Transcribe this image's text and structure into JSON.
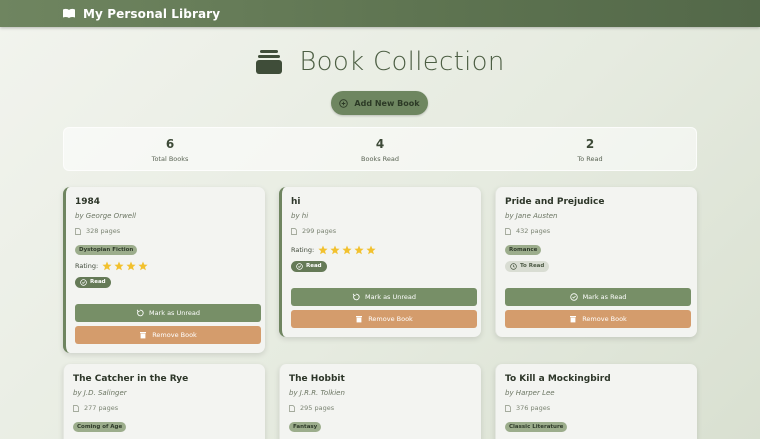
{
  "app": {
    "title": "My Personal Library"
  },
  "header": {
    "title": "Book Collection",
    "add_button": "Add New Book"
  },
  "stats": [
    {
      "value": "6",
      "label": "Total Books"
    },
    {
      "value": "4",
      "label": "Books Read"
    },
    {
      "value": "2",
      "label": "To Read"
    }
  ],
  "colors": {
    "accent": "#6f8560",
    "danger": "#d49c6c",
    "star": "#f2c12e",
    "background": "#e6ebe0"
  },
  "labels": {
    "rating": "Rating:",
    "read": "Read",
    "to_read": "To Read",
    "mark_unread": "Mark as Unread",
    "mark_read": "Mark as Read",
    "remove": "Remove Book"
  },
  "books": [
    {
      "title": "1984",
      "author": "by George Orwell",
      "pages": "328 pages",
      "genre": "Dystopian Fiction",
      "rating": 4,
      "status": "Read",
      "action": "Mark as Unread",
      "remove": "Remove Book"
    },
    {
      "title": "hi",
      "author": "by hi",
      "pages": "299 pages",
      "genre": "",
      "rating": 5,
      "status": "Read",
      "action": "Mark as Unread",
      "remove": "Remove Book"
    },
    {
      "title": "Pride and Prejudice",
      "author": "by Jane Austen",
      "pages": "432 pages",
      "genre": "Romance",
      "rating": 0,
      "status": "To Read",
      "action": "Mark as Read",
      "remove": "Remove Book"
    },
    {
      "title": "The Catcher in the Rye",
      "author": "by J.D. Salinger",
      "pages": "277 pages",
      "genre": "Coming of Age"
    },
    {
      "title": "The Hobbit",
      "author": "by J.R.R. Tolkien",
      "pages": "295 pages",
      "genre": "Fantasy"
    },
    {
      "title": "To Kill a Mockingbird",
      "author": "by Harper Lee",
      "pages": "376 pages",
      "genre": "Classic Literature"
    }
  ]
}
